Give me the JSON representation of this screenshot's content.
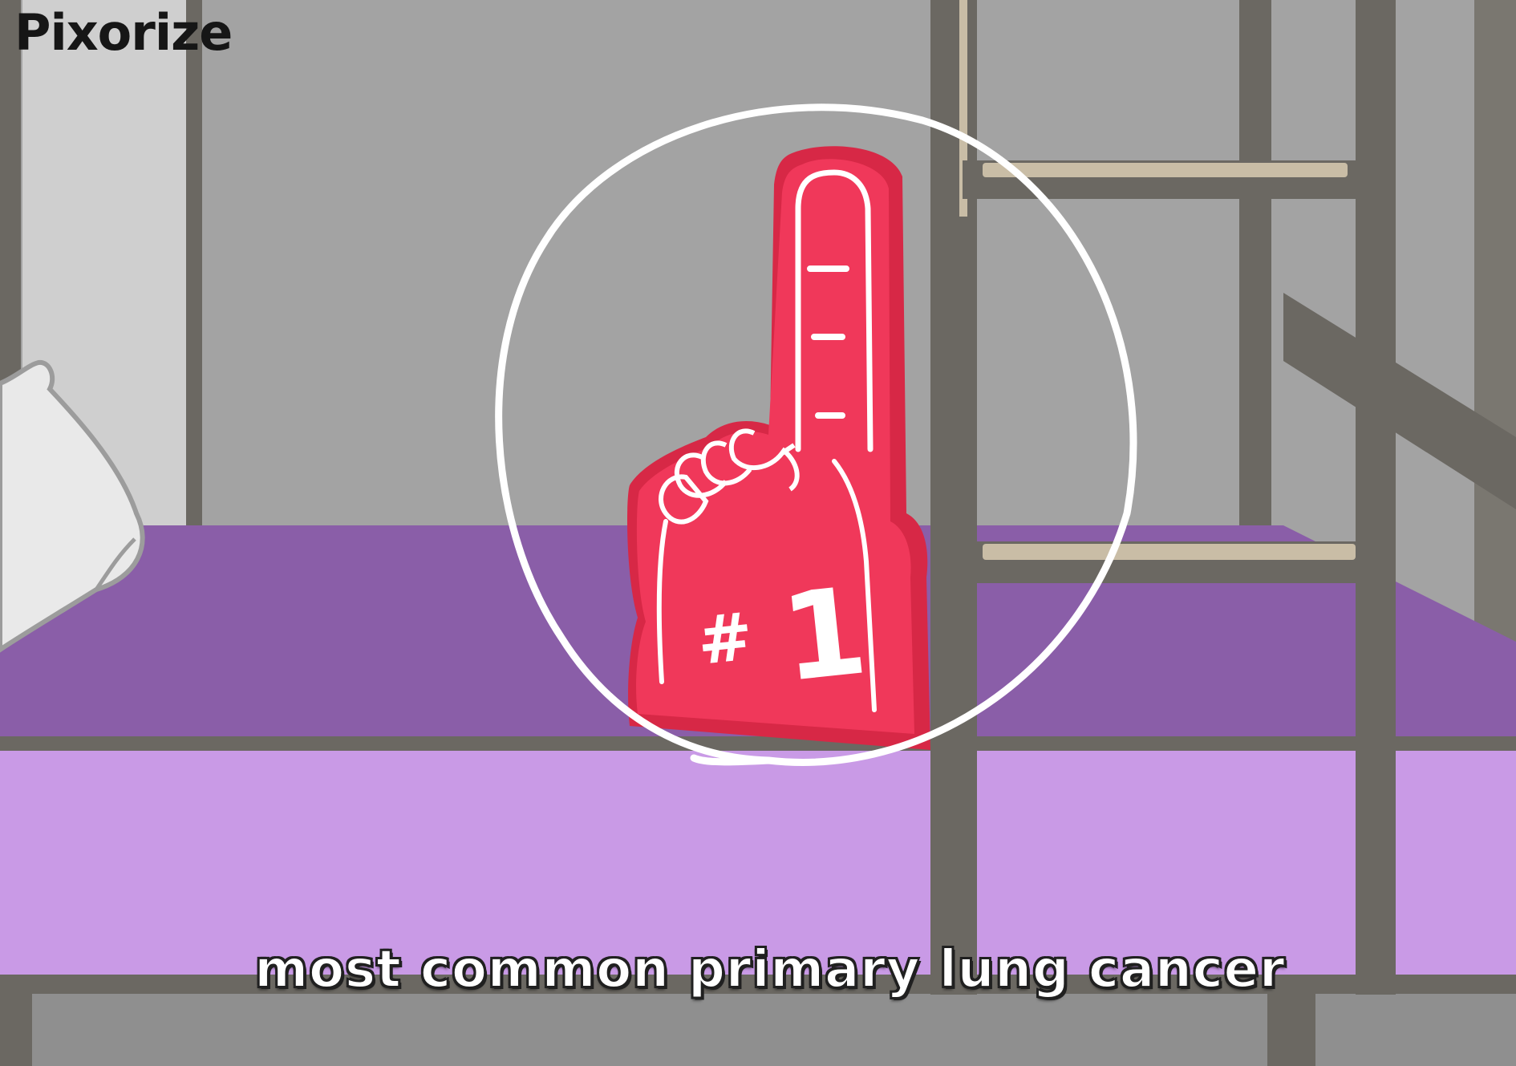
{
  "brand": {
    "logo_text": "Pixorize"
  },
  "caption": {
    "text": "most common primary lung cancer"
  },
  "illustration": {
    "foam_finger": {
      "label_hash": "#",
      "label_number": "1"
    },
    "objects": [
      "bunk-bed",
      "ladder",
      "pillow",
      "foam-finger-icon",
      "highlight-circle"
    ]
  },
  "colors": {
    "wall": "#a3a3a3",
    "bed_frame": "#6b6862",
    "mattress_top": "#8a5ea8",
    "mattress_side": "#c99ae6",
    "foam_finger": "#f0385a",
    "caption_text": "#ffffff",
    "logo_text": "#161616"
  }
}
